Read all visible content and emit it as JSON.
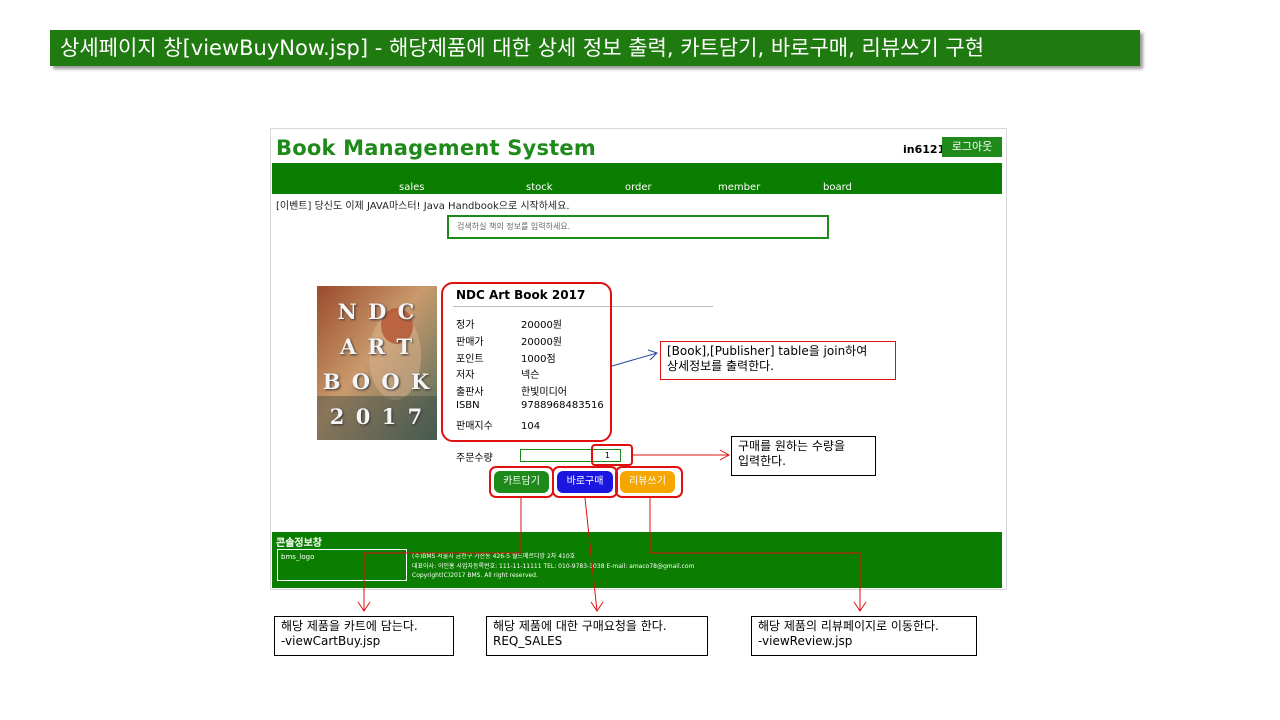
{
  "slide_title": "상세페이지 창[viewBuyNow.jsp] - 해당제품에 대한 상세 정보 출력, 카트담기, 바로구매, 리뷰쓰기 구현",
  "header": {
    "logo": "Book Management System",
    "user_id": "in6121",
    "logout": "로그아웃"
  },
  "nav": [
    "sales",
    "stock",
    "order",
    "member",
    "board"
  ],
  "event_text": "[이벤트] 당신도 이제 JAVA마스터! Java Handbook으로 시작하세요.",
  "search": {
    "placeholder": "검색하실 책의 정보를 입력하세요."
  },
  "cover_icon": "book-cover-image",
  "book": {
    "title": "NDC Art Book 2017",
    "cover_text": [
      "N D C",
      "A R T",
      "B O O K",
      "2 0 1 7"
    ],
    "rows": [
      {
        "label": "정가",
        "value": "20000원"
      },
      {
        "label": "판매가",
        "value": "20000원"
      },
      {
        "label": "포인트",
        "value": "1000점"
      },
      {
        "label": "저자",
        "value": "넥슨"
      },
      {
        "label": "출판사",
        "value": "한빛미디어"
      },
      {
        "label": "ISBN",
        "value": "9788968483516"
      },
      {
        "label": "판매지수",
        "value": "104"
      }
    ]
  },
  "order": {
    "qty_label": "주문수량",
    "qty_value": "1"
  },
  "buttons": {
    "cart": "카트담기",
    "buy": "바로구매",
    "review": "리뷰쓰기"
  },
  "colors": {
    "green": "#0b7d00",
    "blue": "#1a16e0",
    "orange": "#f5a600",
    "red": "#e01010"
  },
  "footer": {
    "title": "콘솔정보창",
    "logo": "bms_logo",
    "lines": [
      "(주)BMS 서울시 금천구 가산동 426-5 월드메르디앙 2차 410호",
      "대표이사: 이인홍 사업자등록번호: 111-11-11111 TEL: 010-9783-3038 E-mail: amaco78@gmail.com",
      "Copyright(C)2017 BMS. All right reserved."
    ]
  },
  "notes": {
    "join": [
      "[Book],[Publisher] table을 join하여",
      "상세정보를 출력한다."
    ],
    "qty": [
      "구매를 원하는 수량을",
      "입력한다."
    ],
    "cart": [
      "해당 제품을 카트에 담는다.",
      "-viewCartBuy.jsp"
    ],
    "buy": [
      "해당 제품에 대한 구매요청을 한다.",
      "REQ_SALES"
    ],
    "review": [
      "해당 제품의 리뷰페이지로 이동한다.",
      "-viewReview.jsp"
    ]
  }
}
